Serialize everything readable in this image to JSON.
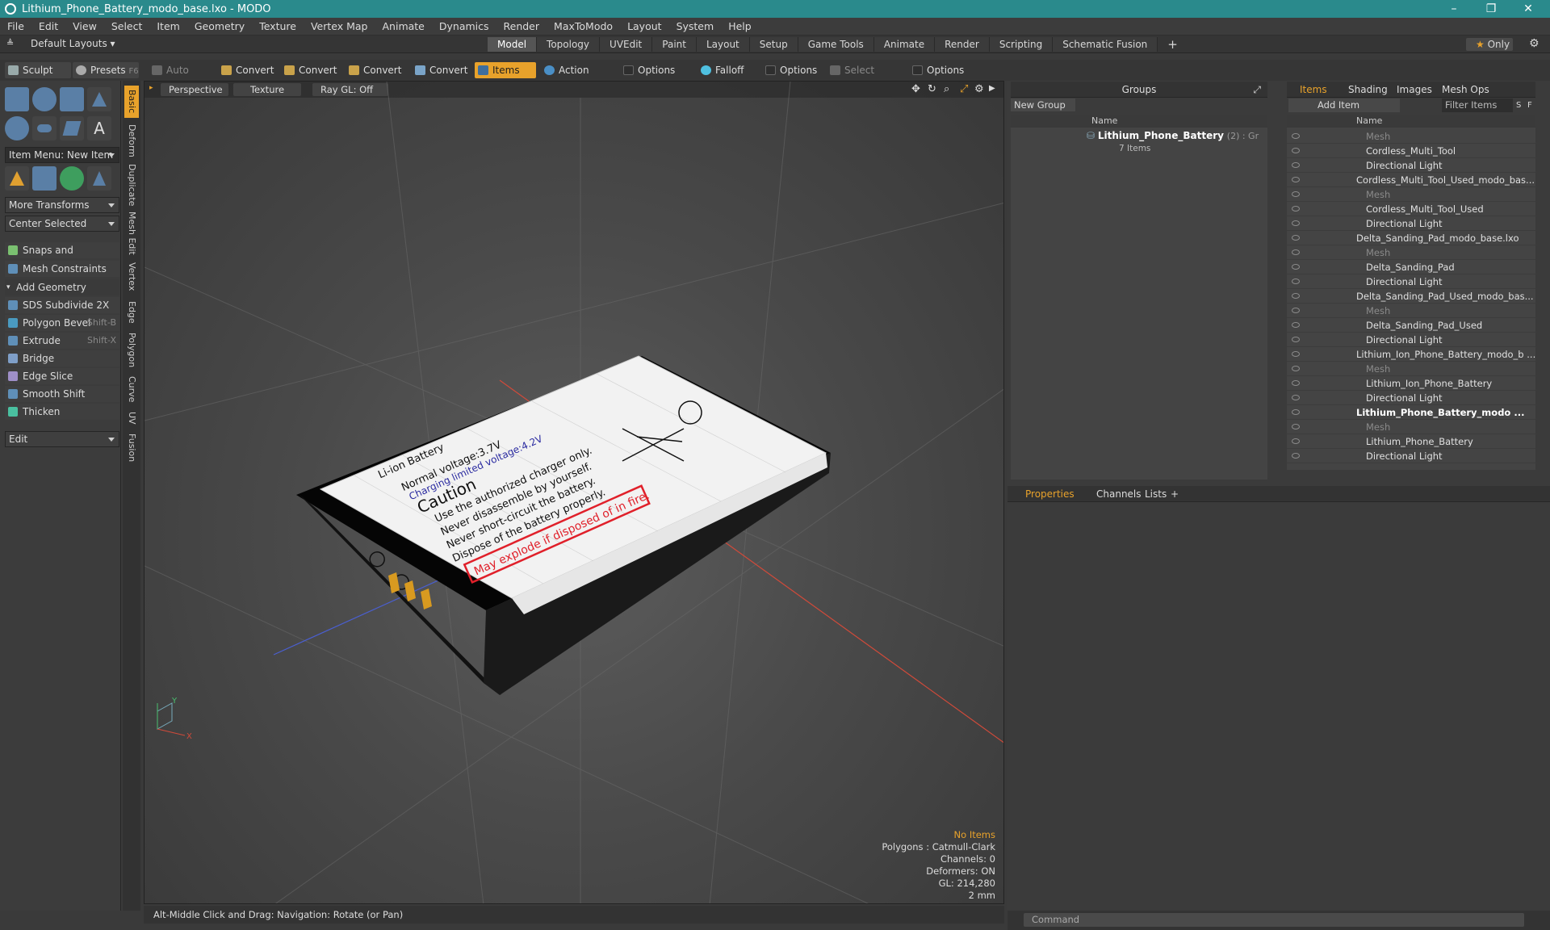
{
  "window": {
    "title": "Lithium_Phone_Battery_modo_base.lxo - MODO",
    "controls": [
      "minimize-icon",
      "restore-icon",
      "close-icon"
    ]
  },
  "menu": [
    "File",
    "Edit",
    "View",
    "Select",
    "Item",
    "Geometry",
    "Texture",
    "Vertex Map",
    "Animate",
    "Dynamics",
    "Render",
    "MaxToModo",
    "Layout",
    "System",
    "Help"
  ],
  "layout": {
    "default_layouts": "Default Layouts",
    "tabs": [
      "Model",
      "Topology",
      "UVEdit",
      "Paint",
      "Layout",
      "Setup",
      "Game Tools",
      "Animate",
      "Render",
      "Scripting",
      "Schematic Fusion"
    ],
    "active_tab": "Model",
    "only": "Only",
    "add": "+"
  },
  "toolbar": {
    "sculpt": "Sculpt",
    "presets": "Presets",
    "presets_key": "F6",
    "auto_select": "Auto Select",
    "convert": "Convert",
    "items": "Items",
    "action_center": "Action Center",
    "options": "Options",
    "falloff": "Falloff",
    "select_through": "Select Through"
  },
  "left": {
    "item_menu": "Item Menu: New Item",
    "more_transforms": "More Transforms",
    "center_selected": "Center Selected",
    "snaps": "Snaps and Precision",
    "mesh_constraints": "Mesh Constraints",
    "add_geometry": "Add Geometry",
    "tools": [
      {
        "label": "SDS Subdivide 2X",
        "key": ""
      },
      {
        "label": "Polygon Bevel",
        "key": "Shift-B"
      },
      {
        "label": "Extrude",
        "key": "Shift-X"
      },
      {
        "label": "Bridge",
        "key": ""
      },
      {
        "label": "Edge Slice",
        "key": ""
      },
      {
        "label": "Smooth Shift",
        "key": ""
      },
      {
        "label": "Thicken",
        "key": ""
      }
    ],
    "edit": "Edit",
    "vtabs": [
      "Basic",
      "Deform",
      "Duplicate",
      "Mesh Edit",
      "Vertex",
      "Edge",
      "Polygon",
      "Curve",
      "UV",
      "Fusion"
    ]
  },
  "viewport": {
    "view": "Perspective",
    "shading": "Texture",
    "raygl": "Ray GL: Off",
    "info": [
      "No Items",
      "Polygons : Catmull-Clark",
      "Channels: 0",
      "Deformers: ON",
      "GL: 214,280",
      "2 mm"
    ],
    "axis": {
      "x": "X",
      "y": "Y"
    },
    "battery": {
      "brand": "Li-ion Battery",
      "nominal": "Normal voltage:3.7V",
      "charging": "Charging limited voltage:4.2V",
      "caution": "Caution",
      "lines": [
        "Use the authorized charger only.",
        "Never disassemble by yourself.",
        "Never short-circuit the battery.",
        "Dispose of the battery properly."
      ],
      "warning": "May explode if disposed of in fire.",
      "minus": "−",
      "plus": "+"
    }
  },
  "status": "Alt-Middle Click and Drag:   Navigation: Rotate (or Pan)",
  "groups": {
    "title": "Groups",
    "new_group": "New Group",
    "col_name": "Name",
    "group_name": "Lithium_Phone_Battery",
    "group_count": "(2) : Gr",
    "group_items": "7 Items"
  },
  "items": {
    "tabs": [
      "Items",
      "Shading",
      "Images",
      "Mesh Ops"
    ],
    "add_item": "Add Item",
    "filter": "Filter Items",
    "col_name": "Name",
    "S": "S",
    "F": "F",
    "rows": [
      {
        "name": "Mesh",
        "indent": 2,
        "type": "mesh"
      },
      {
        "name": "Cordless_Multi_Tool",
        "indent": 2,
        "type": "item"
      },
      {
        "name": "Directional Light",
        "indent": 2,
        "type": "item"
      },
      {
        "name": "Cordless_Multi_Tool_Used_modo_bas...",
        "indent": 1,
        "type": "scene"
      },
      {
        "name": "Mesh",
        "indent": 2,
        "type": "mesh"
      },
      {
        "name": "Cordless_Multi_Tool_Used",
        "indent": 2,
        "type": "item"
      },
      {
        "name": "Directional Light",
        "indent": 2,
        "type": "item"
      },
      {
        "name": "Delta_Sanding_Pad_modo_base.lxo",
        "indent": 1,
        "type": "scene"
      },
      {
        "name": "Mesh",
        "indent": 2,
        "type": "mesh"
      },
      {
        "name": "Delta_Sanding_Pad",
        "indent": 2,
        "type": "item"
      },
      {
        "name": "Directional Light",
        "indent": 2,
        "type": "item"
      },
      {
        "name": "Delta_Sanding_Pad_Used_modo_bas...",
        "indent": 1,
        "type": "scene"
      },
      {
        "name": "Mesh",
        "indent": 2,
        "type": "mesh"
      },
      {
        "name": "Delta_Sanding_Pad_Used",
        "indent": 2,
        "type": "item"
      },
      {
        "name": "Directional Light",
        "indent": 2,
        "type": "item"
      },
      {
        "name": "Lithium_Ion_Phone_Battery_modo_b ...",
        "indent": 1,
        "type": "scene"
      },
      {
        "name": "Mesh",
        "indent": 2,
        "type": "mesh"
      },
      {
        "name": "Lithium_Ion_Phone_Battery",
        "indent": 2,
        "type": "item"
      },
      {
        "name": "Directional Light",
        "indent": 2,
        "type": "item"
      },
      {
        "name": "Lithium_Phone_Battery_modo ...",
        "indent": 1,
        "type": "scene_bold"
      },
      {
        "name": "Mesh",
        "indent": 2,
        "type": "mesh"
      },
      {
        "name": "Lithium_Phone_Battery",
        "indent": 2,
        "type": "item"
      },
      {
        "name": "Directional Light",
        "indent": 2,
        "type": "item"
      }
    ]
  },
  "props": {
    "tabs": [
      "Properties",
      "Channels",
      "Lists"
    ],
    "add": "+"
  },
  "command": {
    "placeholder": "Command"
  },
  "colors": {
    "accent": "#e8a22b",
    "titlebar": "#2a8a8c",
    "warning_red": "#e0202a"
  }
}
